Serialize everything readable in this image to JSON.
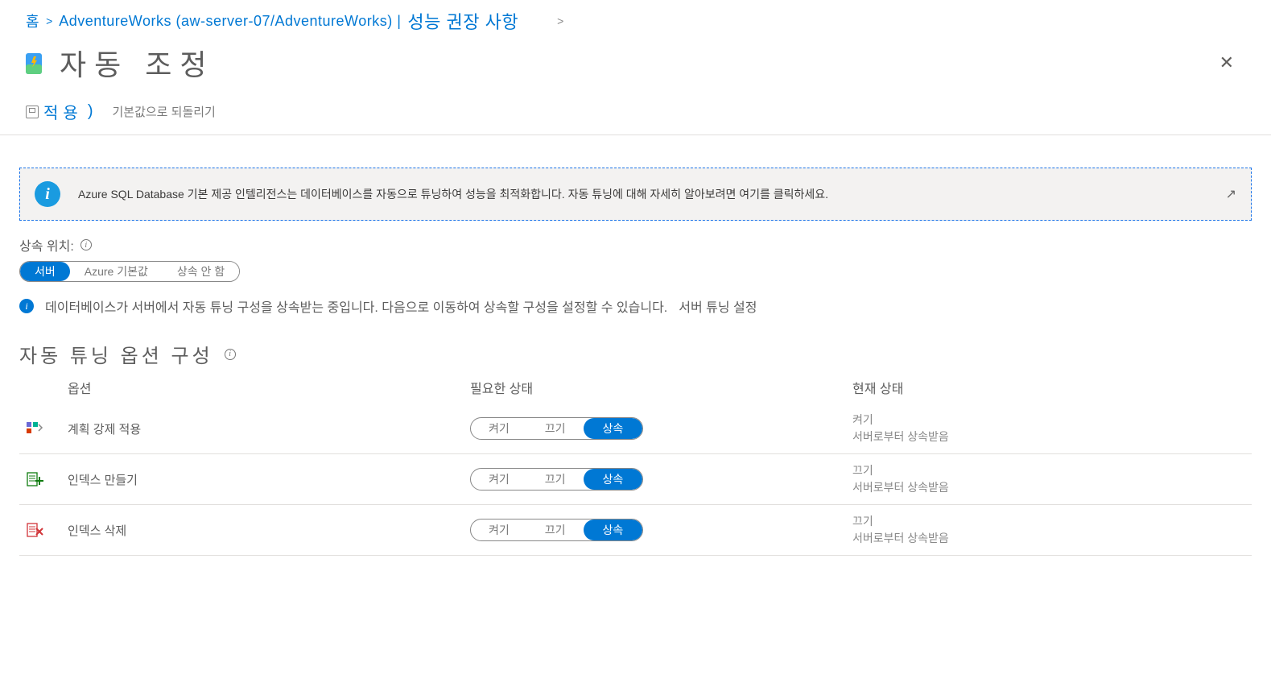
{
  "breadcrumb": {
    "home": "홈",
    "resource": "AdventureWorks (aw-server-07/AdventureWorks) |",
    "perf": "성능 권장 사항"
  },
  "page": {
    "title": "자동 조정"
  },
  "toolbar": {
    "apply": "적용",
    "applyParen": ")",
    "reset": "기본값으로 되돌리기"
  },
  "banner": {
    "text": "Azure SQL Database 기본 제공 인텔리전스는 데이터베이스를 자동으로 튜닝하여 성능을 최적화합니다. 자동 튜닝에 대해 자세히 알아보려면 여기를 클릭하세요."
  },
  "inherit": {
    "label": "상속 위치:",
    "opt_server": "서버",
    "opt_azure_default": "Azure 기본값",
    "opt_none": "상속 안 함",
    "note_text": "데이터베이스가 서버에서 자동 튜닝 구성을 상속받는 중입니다. 다음으로 이동하여 상속할 구성을 설정할 수 있습니다.",
    "note_link": "서버 튜닝 설정"
  },
  "section": {
    "heading": "자동 튜닝 옵션 구성"
  },
  "columns": {
    "option": "옵션",
    "desired": "필요한 상태",
    "current": "현재 상태"
  },
  "tri": {
    "on": "켜기",
    "off": "끄기",
    "inherit": "상속"
  },
  "options": [
    {
      "name": "계획 강제 적용",
      "current_state": "켜기",
      "current_source": "서버로부터 상속받음",
      "icon_colors": {
        "a": "#6b69d6",
        "b": "#00b294",
        "c": "#d83b01"
      }
    },
    {
      "name": "인덱스 만들기",
      "current_state": "끄기",
      "current_source": "서버로부터 상속받음",
      "icon_colors": {
        "a": "#107c10",
        "b": "#107c10",
        "c": "#107c10"
      }
    },
    {
      "name": "인덱스 삭제",
      "current_state": "끄기",
      "current_source": "서버로부터 상속받음",
      "icon_colors": {
        "a": "#d13438",
        "b": "#d13438",
        "c": "#d13438"
      }
    }
  ]
}
